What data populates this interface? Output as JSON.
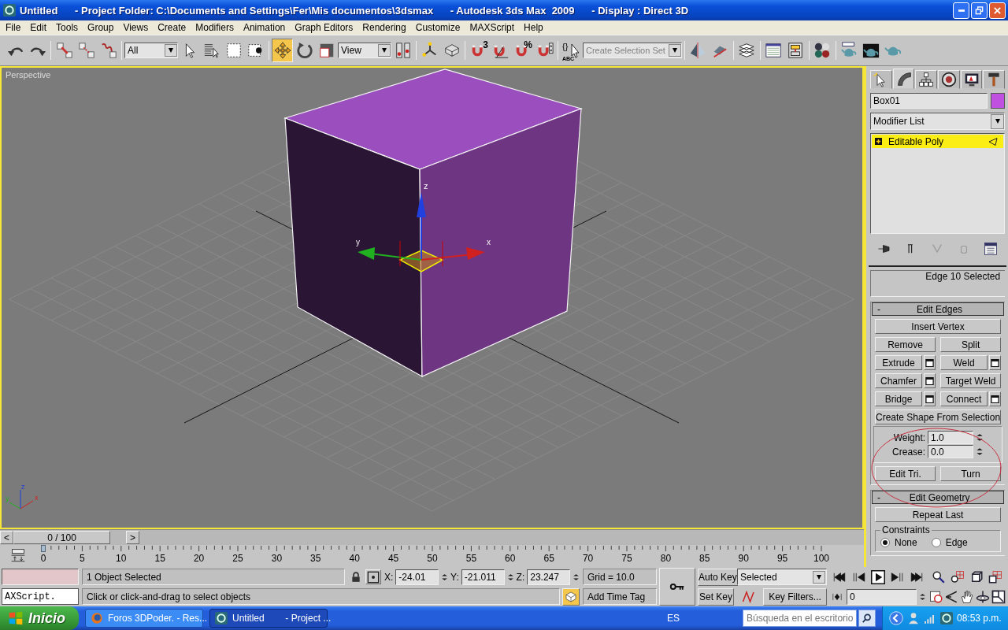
{
  "window": {
    "title": "Untitled      - Project Folder: C:\\Documents and Settings\\Fer\\Mis documentos\\3dsmax      - Autodesk 3ds Max  2009      - Display : Direct 3D"
  },
  "menu": [
    "File",
    "Edit",
    "Tools",
    "Group",
    "Views",
    "Create",
    "Modifiers",
    "Animation",
    "Graph Editors",
    "Rendering",
    "Customize",
    "MAXScript",
    "Help"
  ],
  "toolbar": {
    "items": [
      {
        "kind": "undo",
        "selected": false
      },
      {
        "kind": "redo",
        "selected": false
      },
      {
        "kind": "sep"
      },
      {
        "kind": "link",
        "selected": false
      },
      {
        "kind": "unlink",
        "selected": false
      },
      {
        "kind": "bind",
        "selected": false
      },
      {
        "kind": "sep"
      },
      {
        "kind": "dropdown",
        "value": "All"
      },
      {
        "kind": "select",
        "selected": false
      },
      {
        "kind": "select-by-name",
        "selected": false
      },
      {
        "kind": "rect-region",
        "selected": false
      },
      {
        "kind": "window-crossing",
        "selected": false
      },
      {
        "kind": "sep"
      },
      {
        "kind": "move",
        "selected": true
      },
      {
        "kind": "rotate",
        "selected": false
      },
      {
        "kind": "scale",
        "selected": false
      },
      {
        "kind": "dropdown",
        "value": "View"
      },
      {
        "kind": "pivot",
        "selected": false
      },
      {
        "kind": "sep"
      },
      {
        "kind": "manipulate",
        "selected": false
      },
      {
        "kind": "keyboard",
        "selected": false
      },
      {
        "kind": "sep"
      },
      {
        "kind": "snap",
        "badge": "3",
        "selected": false
      },
      {
        "kind": "angle-snap",
        "selected": false
      },
      {
        "kind": "snap",
        "badge": "%",
        "selected": false
      },
      {
        "kind": "spinner-snap",
        "selected": false
      },
      {
        "kind": "sep"
      },
      {
        "kind": "named-sets",
        "badge": "{}",
        "caption": "ABC",
        "selected": false
      },
      {
        "kind": "dropdown",
        "placeholder": "Create Selection Set"
      },
      {
        "kind": "sep"
      },
      {
        "kind": "mirror",
        "selected": false
      },
      {
        "kind": "align",
        "selected": false
      },
      {
        "kind": "sep"
      },
      {
        "kind": "layers",
        "selected": false
      },
      {
        "kind": "sep"
      },
      {
        "kind": "curve-editor",
        "selected": false
      },
      {
        "kind": "schematic",
        "selected": false
      },
      {
        "kind": "sep"
      },
      {
        "kind": "material",
        "selected": false
      },
      {
        "kind": "sep"
      },
      {
        "kind": "render-setup",
        "selected": false
      },
      {
        "kind": "rendered-frame",
        "selected": false
      },
      {
        "kind": "quick-render",
        "selected": false
      }
    ]
  },
  "viewport": {
    "label": "Perspective",
    "active": true,
    "gizmo_axes": [
      "z",
      "x",
      "y"
    ],
    "tripod_axes": [
      "z",
      "y",
      "x"
    ]
  },
  "command_panel": {
    "tabs": [
      {
        "kind": "create",
        "selected": false
      },
      {
        "kind": "modify",
        "selected": true
      },
      {
        "kind": "hierarchy",
        "selected": false
      },
      {
        "kind": "motion",
        "selected": false
      },
      {
        "kind": "display",
        "selected": false
      },
      {
        "kind": "utilities",
        "selected": false
      }
    ],
    "object_name": "Box01",
    "modifier_list": "Modifier List",
    "stack": [
      {
        "label": "Editable Poly",
        "selected": true
      }
    ],
    "selection_info": "Edge 10 Selected",
    "rollouts": [
      {
        "toggle": "-",
        "title": "Edit Edges",
        "rows": [
          {
            "kind": "buttons",
            "buttons": [
              {
                "label": "Insert Vertex",
                "settings": false
              }
            ]
          },
          {
            "kind": "buttons",
            "buttons": [
              {
                "label": "Remove",
                "settings": false
              },
              {
                "label": "Split",
                "settings": false
              }
            ]
          },
          {
            "kind": "buttons",
            "buttons": [
              {
                "label": "Extrude",
                "settings": true
              },
              {
                "label": "Weld",
                "settings": true
              }
            ]
          },
          {
            "kind": "buttons",
            "buttons": [
              {
                "label": "Chamfer",
                "settings": true
              },
              {
                "label": "Target Weld",
                "settings": false
              }
            ]
          },
          {
            "kind": "buttons",
            "buttons": [
              {
                "label": "Bridge",
                "settings": true
              },
              {
                "label": "Connect",
                "settings": true
              }
            ]
          },
          {
            "kind": "buttons",
            "buttons": [
              {
                "label": "Create Shape From Selection",
                "settings": false
              }
            ]
          },
          {
            "kind": "spinners",
            "fields": [
              {
                "label": "Weight:",
                "value": "1.0"
              },
              {
                "label": "Crease:",
                "value": "0.0"
              }
            ]
          },
          {
            "kind": "buttons",
            "buttons": [
              {
                "label": "Edit Tri.",
                "settings": false
              },
              {
                "label": "Turn",
                "settings": false
              }
            ]
          }
        ]
      },
      {
        "toggle": "-",
        "title": "Edit Geometry",
        "rows": [
          {
            "kind": "buttons",
            "buttons": [
              {
                "label": "Repeat Last",
                "settings": false
              }
            ]
          },
          {
            "kind": "group",
            "title": "Constraints",
            "radios": [
              {
                "label": "None",
                "selected": true
              },
              {
                "label": "Edge",
                "selected": false
              }
            ]
          }
        ]
      }
    ]
  },
  "timeline": {
    "prev": "<",
    "frame": "0 / 100",
    "next": ">",
    "level": 0
  },
  "trackbar": {
    "ticks": [
      "0",
      "5",
      "10",
      "15",
      "20",
      "25",
      "30",
      "35",
      "40",
      "45",
      "50",
      "55",
      "60",
      "65",
      "70",
      "75",
      "80",
      "85",
      "90",
      "95",
      "100"
    ]
  },
  "status": {
    "listener": "AXScript.",
    "selection": "1 Object Selected",
    "prompt": "Click or click-and-drag to select objects",
    "coords": [
      {
        "label": "X:",
        "value": "-24.01"
      },
      {
        "label": "Y:",
        "value": "-21.011"
      },
      {
        "label": "Z:",
        "value": "23.247"
      }
    ],
    "grid": "Grid = 10.0",
    "time_tag": "Add Time Tag",
    "auto_key": "Auto Key",
    "set_key": "Set Key",
    "key_set": "Selected",
    "key_filters": "Key Filters...",
    "frame": "0"
  },
  "taskbar": {
    "start": "Inicio",
    "tasks": [
      {
        "label": "Foros 3DPoder. - Res...",
        "selected": false
      },
      {
        "label": "Untitled        - Project ...",
        "selected": true
      }
    ],
    "language": "ES",
    "search_placeholder": "Búsqueda en el escritorio",
    "clock": "08:53 p.m."
  }
}
